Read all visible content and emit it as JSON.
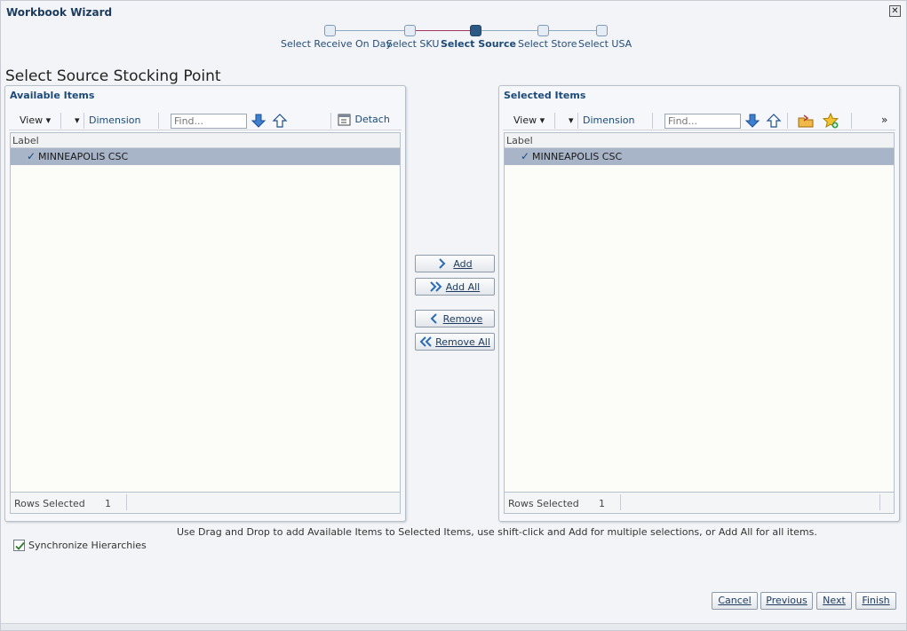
{
  "window": {
    "title": "Workbook Wizard"
  },
  "train": {
    "steps": [
      {
        "label": "Select Receive On Day",
        "state": "visited"
      },
      {
        "label": "Select SKU",
        "state": "visited"
      },
      {
        "label": "Select Source",
        "state": "current"
      },
      {
        "label": "Select Store",
        "state": "unvisited"
      },
      {
        "label": "Select USA",
        "state": "unvisited"
      }
    ]
  },
  "page": {
    "title": "Select Source Stocking Point"
  },
  "available": {
    "header": "Available Items",
    "toolbar": {
      "view": "View",
      "dimension": "Dimension",
      "find_placeholder": "Find...",
      "detach": "Detach"
    },
    "column": "Label",
    "rows": [
      {
        "label": "MINNEAPOLIS CSC",
        "selected": true
      }
    ],
    "status": {
      "label": "Rows Selected",
      "count": "1"
    }
  },
  "selected": {
    "header": "Selected Items",
    "toolbar": {
      "view": "View",
      "dimension": "Dimension",
      "find_placeholder": "Find...",
      "overflow": "»"
    },
    "column": "Label",
    "rows": [
      {
        "label": "MINNEAPOLIS CSC",
        "selected": true
      }
    ],
    "status": {
      "label": "Rows Selected",
      "count": "1"
    }
  },
  "shuttle": {
    "add": "Add",
    "add_all": "Add All",
    "remove": "Remove",
    "remove_all": "Remove All"
  },
  "hint": "Use Drag and Drop to add Available Items to Selected Items, use shift-click and Add for multiple selections, or Add All for all items.",
  "sync": {
    "label": "Synchronize Hierarchies",
    "checked": true
  },
  "footer": {
    "cancel": "Cancel",
    "previous": "Previous",
    "next": "Next",
    "finish": "Finish"
  },
  "colors": {
    "accent": "#1c4a78",
    "selection": "#a8b4c8",
    "train_done": "#a53863"
  }
}
